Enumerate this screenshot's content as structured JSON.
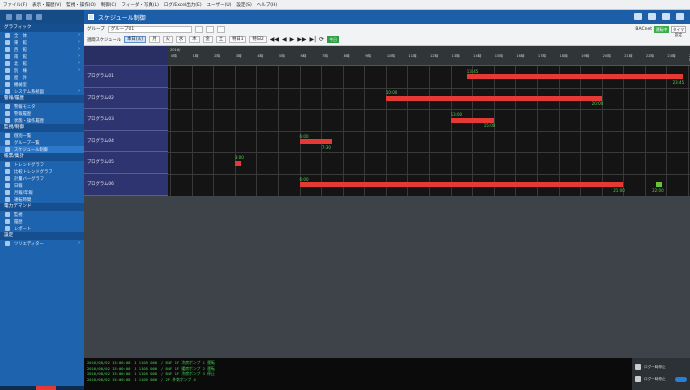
{
  "menubar": [
    "ファイル(F)",
    "表示・履歴(V)",
    "監視・操作(O)",
    "制御(C)",
    "フィーダ・写真(L)",
    "ログ/Excel出力(E)",
    "ユーザー(U)",
    "設定(S)",
    "ヘルプ(H)"
  ],
  "window": {
    "title": "スケジュール制御"
  },
  "sidebar": {
    "sections": [
      {
        "title": "グラフィック",
        "items": [
          {
            "label": "全　体",
            "chev": "›",
            "icon": "floor-icon"
          },
          {
            "label": "東　館",
            "chev": "›",
            "icon": "floor-icon"
          },
          {
            "label": "西　館",
            "chev": "›",
            "icon": "floor-icon"
          },
          {
            "label": "南　館",
            "chev": "›",
            "icon": "floor-icon"
          },
          {
            "label": "北　館",
            "chev": "›",
            "icon": "floor-icon"
          },
          {
            "label": "別　棟",
            "chev": "›",
            "icon": "floor-icon"
          },
          {
            "label": "屋　外",
            "chev": "",
            "icon": "floor-icon"
          },
          {
            "label": "機械室",
            "chev": "",
            "icon": "floor-icon"
          },
          {
            "label": "システム系統図",
            "chev": "›",
            "icon": "system-icon"
          }
        ]
      },
      {
        "title": "警報/履歴",
        "items": [
          {
            "label": "警報モニタ",
            "icon": "alarm-icon"
          },
          {
            "label": "警報履歴",
            "icon": "history-icon"
          },
          {
            "label": "状態・操作履歴",
            "icon": "list-icon"
          }
        ]
      },
      {
        "title": "監視/制御",
        "items": [
          {
            "label": "個別一覧",
            "icon": "list-icon"
          },
          {
            "label": "グループ一覧",
            "icon": "group-icon"
          },
          {
            "label": "スケジュール制御",
            "icon": "schedule-icon",
            "selected": true
          }
        ]
      },
      {
        "title": "帳票/集計",
        "items": [
          {
            "label": "トレンドグラフ",
            "icon": "trend-icon"
          },
          {
            "label": "比較トレンドグラフ",
            "icon": "trend-icon"
          },
          {
            "label": "計量バーグラフ",
            "icon": "bar-icon"
          },
          {
            "label": "日報",
            "icon": "report-icon"
          },
          {
            "label": "月報/年報",
            "icon": "report-icon"
          },
          {
            "label": "運転時間",
            "icon": "clock-icon"
          }
        ]
      },
      {
        "title": "電力デマンド",
        "items": [
          {
            "label": "監視",
            "icon": "demand-icon"
          },
          {
            "label": "履歴",
            "icon": "demand-icon"
          },
          {
            "label": "レポート",
            "icon": "demand-icon"
          }
        ]
      },
      {
        "title": "設定",
        "items": [
          {
            "label": "ツリエディター",
            "chev": "›",
            "icon": "edit-icon"
          }
        ]
      }
    ]
  },
  "toolbar": {
    "group_label": "グループ",
    "group_value": "グループ01",
    "mode_label": "BACnet",
    "right_btn1": "運転中",
    "right_btn2": "タイマ設定"
  },
  "view_tabs": {
    "label": "週間スケジュール",
    "tabs": [
      "本日(火)",
      "月",
      "火",
      "水",
      "木",
      "金",
      "土",
      "特日1",
      "特日2"
    ],
    "active": 0,
    "today_btn": "今日"
  },
  "gantt": {
    "date_label": "2016/",
    "rows": [
      "プログラム01",
      "プログラム02",
      "プログラム03",
      "プログラム04",
      "プログラム05",
      "プログラム06"
    ],
    "hours": [
      "0時",
      "1時",
      "2時",
      "3時",
      "4時",
      "5時",
      "6時",
      "7時",
      "8時",
      "9時",
      "10時",
      "11時",
      "12時",
      "13時",
      "14時",
      "15時",
      "16時",
      "17時",
      "18時",
      "19時",
      "20時",
      "21時",
      "22時",
      "23時",
      "24時"
    ],
    "bars": [
      {
        "row": 0,
        "start": 13.75,
        "end": 23.75,
        "start_label": "13:45",
        "end_label": "23:45",
        "color": "#e53935"
      },
      {
        "row": 1,
        "start": 10.0,
        "end": 20.0,
        "start_label": "10:00",
        "end_label": "20:00",
        "color": "#e53935"
      },
      {
        "row": 2,
        "start": 13.0,
        "end": 15.0,
        "start_label": "13:00",
        "end_label": "15:00",
        "color": "#e53935"
      },
      {
        "row": 3,
        "start": 6.0,
        "end": 7.5,
        "start_label": "6:00",
        "end_label": "7:30",
        "color": "#e53935"
      },
      {
        "row": 4,
        "start": 3.0,
        "end": 3.3,
        "start_label": "3:00",
        "end_label": "",
        "color": "#e53935"
      },
      {
        "row": 5,
        "start": 6.0,
        "end": 21.0,
        "start_label": "6:00",
        "end_label": "21:00",
        "color": "#e53935"
      },
      {
        "row": 5,
        "start": 22.5,
        "end": 22.8,
        "start_label": "",
        "end_label": "22:00",
        "color": "#67c23a"
      }
    ]
  },
  "log": [
    "2016/08/02 15:00:00　1 1105 000　/ B4F 1F 冷房ポンプ 1 運転",
    "2016/08/02 15:00:00　1 1105 000　/ B4F 1F 暖房ポンプ 2 運転",
    "2016/08/02 15:00:00　1 1105 000　/ B4F 1F 冷房ポンプ 3 停止",
    "2016/08/02 15:00:00　1 1105 000　/ 2F 外気ポンプ 4"
  ],
  "side_panel": {
    "row1": "ログ一時停止",
    "row2": "ログ一時停止"
  }
}
